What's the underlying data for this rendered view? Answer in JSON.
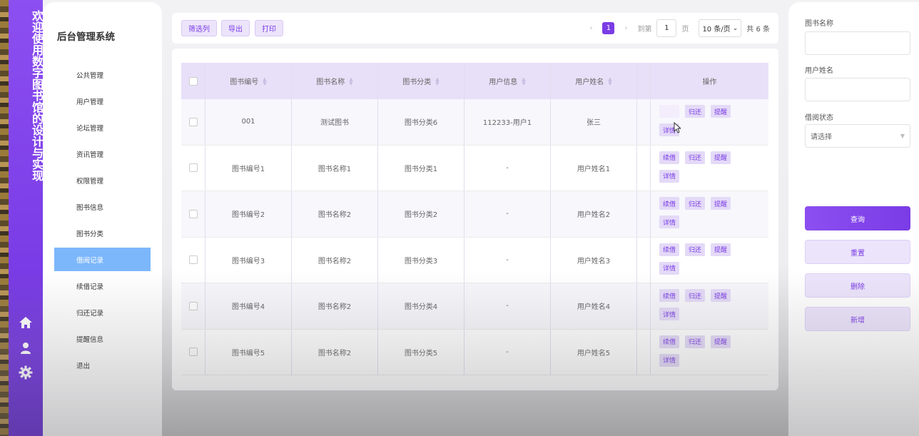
{
  "app": {
    "vertical_title": "欢迎使用数字图书馆的设计与实现",
    "system_title": "后台管理系统"
  },
  "colors": {
    "accent": "#7a3ce6",
    "active_menu": "#7db7fb",
    "table_header": "#e8e0f8"
  },
  "sidebar": {
    "items": [
      {
        "label": "公共管理",
        "active": false
      },
      {
        "label": "用户管理",
        "active": false
      },
      {
        "label": "论坛管理",
        "active": false
      },
      {
        "label": "资讯管理",
        "active": false
      },
      {
        "label": "权限管理",
        "active": false
      },
      {
        "label": "图书信息",
        "active": false
      },
      {
        "label": "图书分类",
        "active": false
      },
      {
        "label": "借阅记录",
        "active": true
      },
      {
        "label": "续借记录",
        "active": false
      },
      {
        "label": "归还记录",
        "active": false
      },
      {
        "label": "提醒信息",
        "active": false
      },
      {
        "label": "退出",
        "active": false
      }
    ],
    "bottom_icons": [
      "home-icon",
      "user-icon",
      "gear-icon"
    ]
  },
  "toolbar": {
    "filter_label": "筛选列",
    "export_label": "导出",
    "print_label": "打印"
  },
  "pager": {
    "current_page": "1",
    "goto_label": "到第",
    "goto_value": "1",
    "page_unit": "页",
    "page_size": "10 条/页",
    "total": "共 6 条"
  },
  "table": {
    "headers": [
      "图书编号",
      "图书名称",
      "图书分类",
      "用户信息",
      "用户姓名",
      "操作"
    ],
    "rows": [
      [
        "001",
        "测试图书",
        "图书分类6",
        "112233-用户1",
        "张三"
      ],
      [
        "图书编号1",
        "图书名称1",
        "图书分类1",
        "-",
        "用户姓名1"
      ],
      [
        "图书编号2",
        "图书名称2",
        "图书分类2",
        "-",
        "用户姓名2"
      ],
      [
        "图书编号3",
        "图书名称2",
        "图书分类3",
        "-",
        "用户姓名3"
      ],
      [
        "图书编号4",
        "图书名称2",
        "图书分类4",
        "-",
        "用户姓名4"
      ],
      [
        "图书编号5",
        "图书名称2",
        "图书分类5",
        "-",
        "用户姓名5"
      ]
    ],
    "actions": {
      "renew": "续借",
      "return": "归还",
      "remind": "提醒",
      "detail": "详情"
    }
  },
  "filters": {
    "book_name_label": "图书名称",
    "user_name_label": "用户姓名",
    "status_label": "借阅状态",
    "status_placeholder": "请选择"
  },
  "buttons": {
    "query": "查询",
    "reset": "重置",
    "delete": "删除",
    "add": "新增"
  }
}
